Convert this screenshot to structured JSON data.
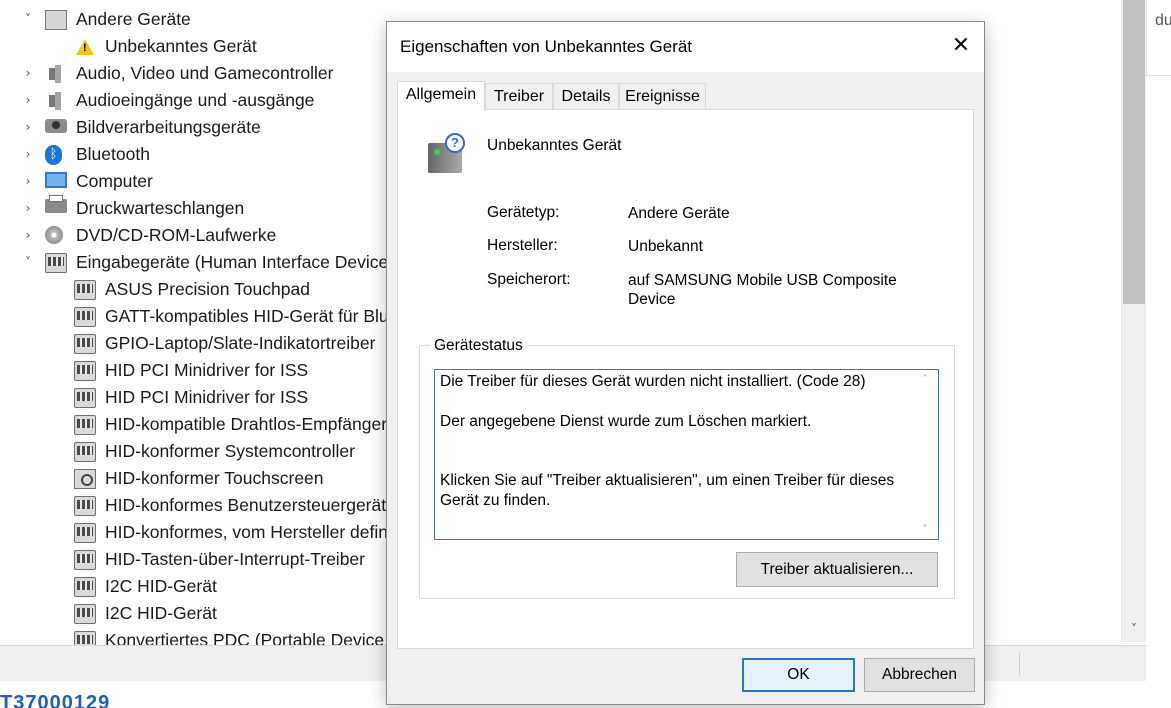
{
  "tree": {
    "rows": [
      {
        "label": "Andere Geräte",
        "chevron": "˅",
        "icon": "unknown-device-icon",
        "indent": 0
      },
      {
        "label": "Unbekanntes Gerät",
        "chevron": "",
        "icon": "warning-device-icon",
        "indent": 1
      },
      {
        "label": "Audio, Video und Gamecontroller",
        "chevron": "›",
        "icon": "speaker-icon",
        "indent": 0
      },
      {
        "label": "Audioeingänge und -ausgänge",
        "chevron": "›",
        "icon": "speaker-icon",
        "indent": 0
      },
      {
        "label": "Bildverarbeitungsgeräte",
        "chevron": "›",
        "icon": "camera-icon",
        "indent": 0
      },
      {
        "label": "Bluetooth",
        "chevron": "›",
        "icon": "bluetooth-icon",
        "indent": 0
      },
      {
        "label": "Computer",
        "chevron": "›",
        "icon": "monitor-icon",
        "indent": 0
      },
      {
        "label": "Druckwarteschlangen",
        "chevron": "›",
        "icon": "printer-icon",
        "indent": 0
      },
      {
        "label": "DVD/CD-ROM-Laufwerke",
        "chevron": "›",
        "icon": "disc-icon",
        "indent": 0
      },
      {
        "label": "Eingabegeräte (Human Interface Devices)",
        "chevron": "˅",
        "icon": "hid-icon",
        "indent": 0
      },
      {
        "label": "ASUS Precision Touchpad",
        "chevron": "",
        "icon": "hid-icon",
        "indent": 1
      },
      {
        "label": "GATT-kompatibles HID-Gerät für Bluetooth",
        "chevron": "",
        "icon": "hid-icon",
        "indent": 1
      },
      {
        "label": "GPIO-Laptop/Slate-Indikatortreiber",
        "chevron": "",
        "icon": "hid-icon",
        "indent": 1
      },
      {
        "label": "HID PCI Minidriver for ISS",
        "chevron": "",
        "icon": "hid-icon",
        "indent": 1
      },
      {
        "label": "HID PCI Minidriver for ISS",
        "chevron": "",
        "icon": "hid-icon",
        "indent": 1
      },
      {
        "label": "HID-kompatible Drahtlos-Empfänger",
        "chevron": "",
        "icon": "hid-icon",
        "indent": 1
      },
      {
        "label": "HID-konformer Systemcontroller",
        "chevron": "",
        "icon": "hid-icon",
        "indent": 1
      },
      {
        "label": "HID-konformer Touchscreen",
        "chevron": "",
        "icon": "touchscreen-icon",
        "indent": 1
      },
      {
        "label": "HID-konformes Benutzersteuergerät",
        "chevron": "",
        "icon": "hid-icon",
        "indent": 1
      },
      {
        "label": "HID-konformes, vom Hersteller definiertes Gerät",
        "chevron": "",
        "icon": "hid-icon",
        "indent": 1
      },
      {
        "label": "HID-Tasten-über-Interrupt-Treiber",
        "chevron": "",
        "icon": "hid-icon",
        "indent": 1
      },
      {
        "label": "I2C HID-Gerät",
        "chevron": "",
        "icon": "hid-icon",
        "indent": 1
      },
      {
        "label": "I2C HID-Gerät",
        "chevron": "",
        "icon": "hid-icon",
        "indent": 1
      },
      {
        "label": "Konvertiertes PDC (Portable Device Control)",
        "chevron": "",
        "icon": "hid-icon",
        "indent": 1
      }
    ]
  },
  "right_strip_text": "du",
  "bottom_text": "T37000129",
  "dialog": {
    "title": "Eigenschaften von Unbekanntes Gerät",
    "close_glyph": "✕",
    "tabs": [
      {
        "label": "Allgemein",
        "active": true
      },
      {
        "label": "Treiber",
        "active": false
      },
      {
        "label": "Details",
        "active": false
      },
      {
        "label": "Ereignisse",
        "active": false
      }
    ],
    "device_name": "Unbekanntes Gerät",
    "properties": {
      "type_label": "Gerätetyp:",
      "type_value": "Andere Geräte",
      "manufacturer_label": "Hersteller:",
      "manufacturer_value": "Unbekannt",
      "location_label": "Speicherort:",
      "location_value": "auf SAMSUNG Mobile USB Composite Device"
    },
    "status_group_title": "Gerätestatus",
    "status_lines": [
      "Die Treiber für dieses Gerät wurden nicht installiert. (Code 28)",
      "Der angegebene Dienst wurde zum Löschen markiert.",
      "Klicken Sie auf \"Treiber aktualisieren\", um einen Treiber für dieses Gerät zu finden."
    ],
    "update_driver_label": "Treiber aktualisieren...",
    "ok_label": "OK",
    "cancel_label": "Abbrechen"
  },
  "colors": {
    "accent": "#2d7ad6",
    "dialog_bg": "#f0f0f0"
  }
}
